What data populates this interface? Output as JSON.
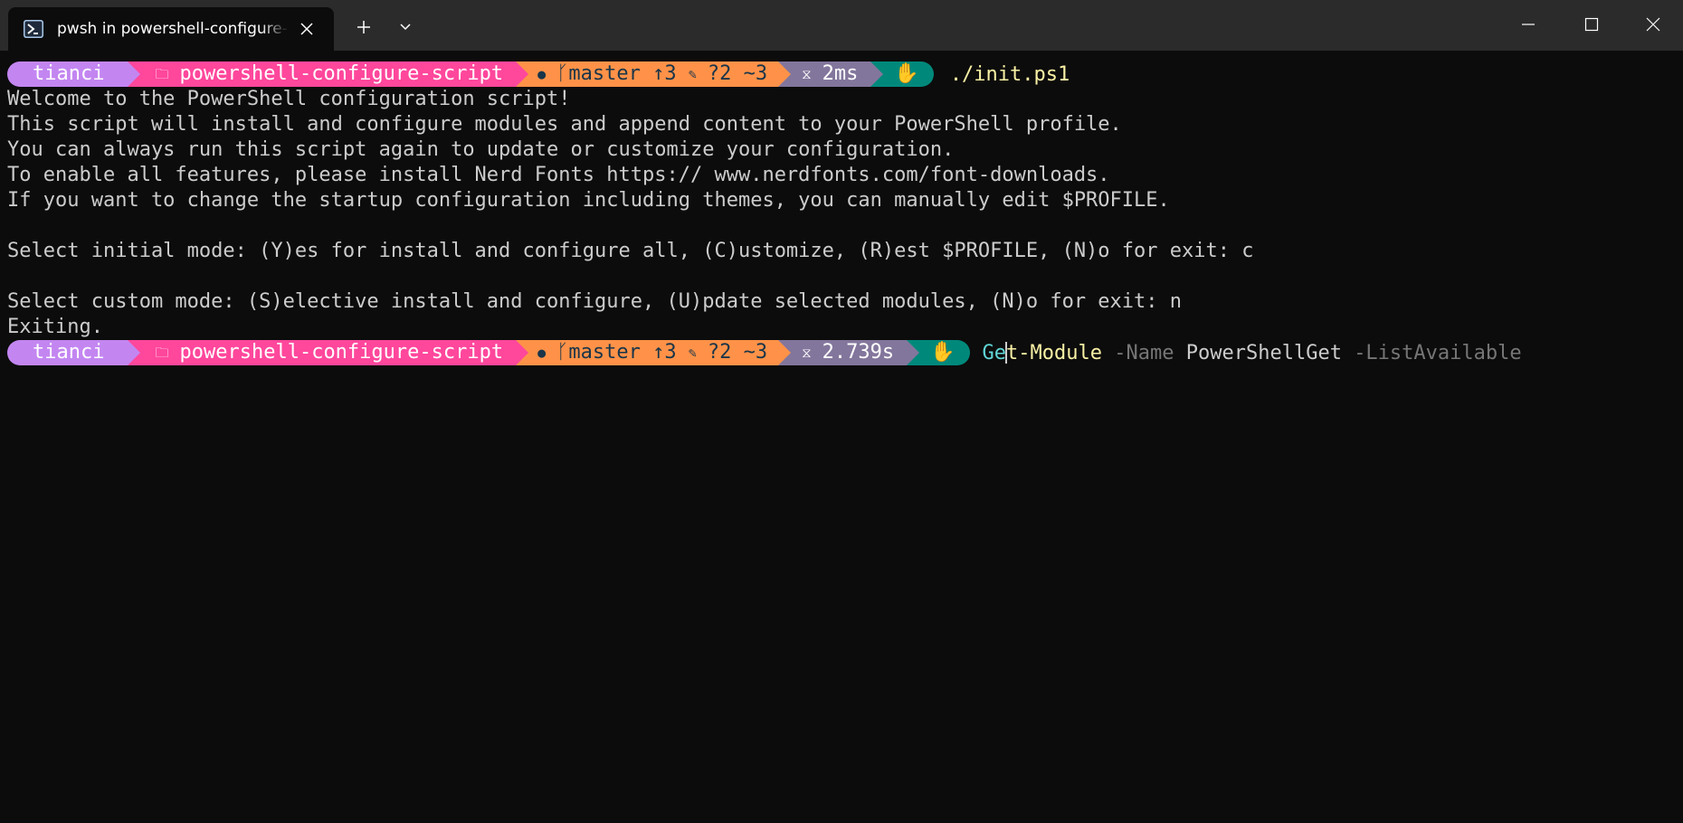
{
  "window": {
    "tab_title": "pwsh in powershell-configure-script",
    "icons": {
      "tab": "powershell-icon",
      "close_tab": "close-icon",
      "new_tab": "plus-icon",
      "dropdown": "chevron-down-icon",
      "minimize": "minimize-icon",
      "maximize": "maximize-icon",
      "close": "close-icon"
    }
  },
  "theme": {
    "background": "#0c0c0c",
    "titlebar": "#2b2b2b",
    "user_segment": "#c386f1",
    "path_segment": "#ff479c",
    "git_segment": "#ff9248",
    "time_segment": "#83769c",
    "exec_segment": "#00897b"
  },
  "prompt1": {
    "user": "tianci",
    "path": "powershell-configure-script",
    "branch": "master",
    "ahead": "↑3",
    "untracked": "?2",
    "modified": "~3",
    "time": "2ms",
    "command": "./init.ps1"
  },
  "output": [
    "Welcome to the PowerShell configuration script!",
    "This script will install and configure modules and append content to your PowerShell profile.",
    "You can always run this script again to update or customize your configuration.",
    "To enable all features, please install Nerd Fonts https:// www.nerdfonts.com/font-downloads.",
    "If you want to change the startup configuration including themes, you can manually edit $PROFILE.",
    "",
    "Select initial mode: (Y)es for install and configure all, (C)ustomize, (R)est $PROFILE, (N)o for exit: c",
    "",
    "Select custom mode: (S)elective install and configure, (U)pdate selected modules, (N)o for exit: n",
    "Exiting."
  ],
  "prompt2": {
    "user": "tianci",
    "path": "powershell-configure-script",
    "branch": "master",
    "ahead": "↑3",
    "untracked": "?2",
    "modified": "~3",
    "time": "2.739s",
    "command_before_cursor": "Ge",
    "command_after_cursor": "t-Module",
    "param_name": "-Name",
    "arg_value": "PowerShellGet",
    "param_list": "-ListAvailable"
  }
}
